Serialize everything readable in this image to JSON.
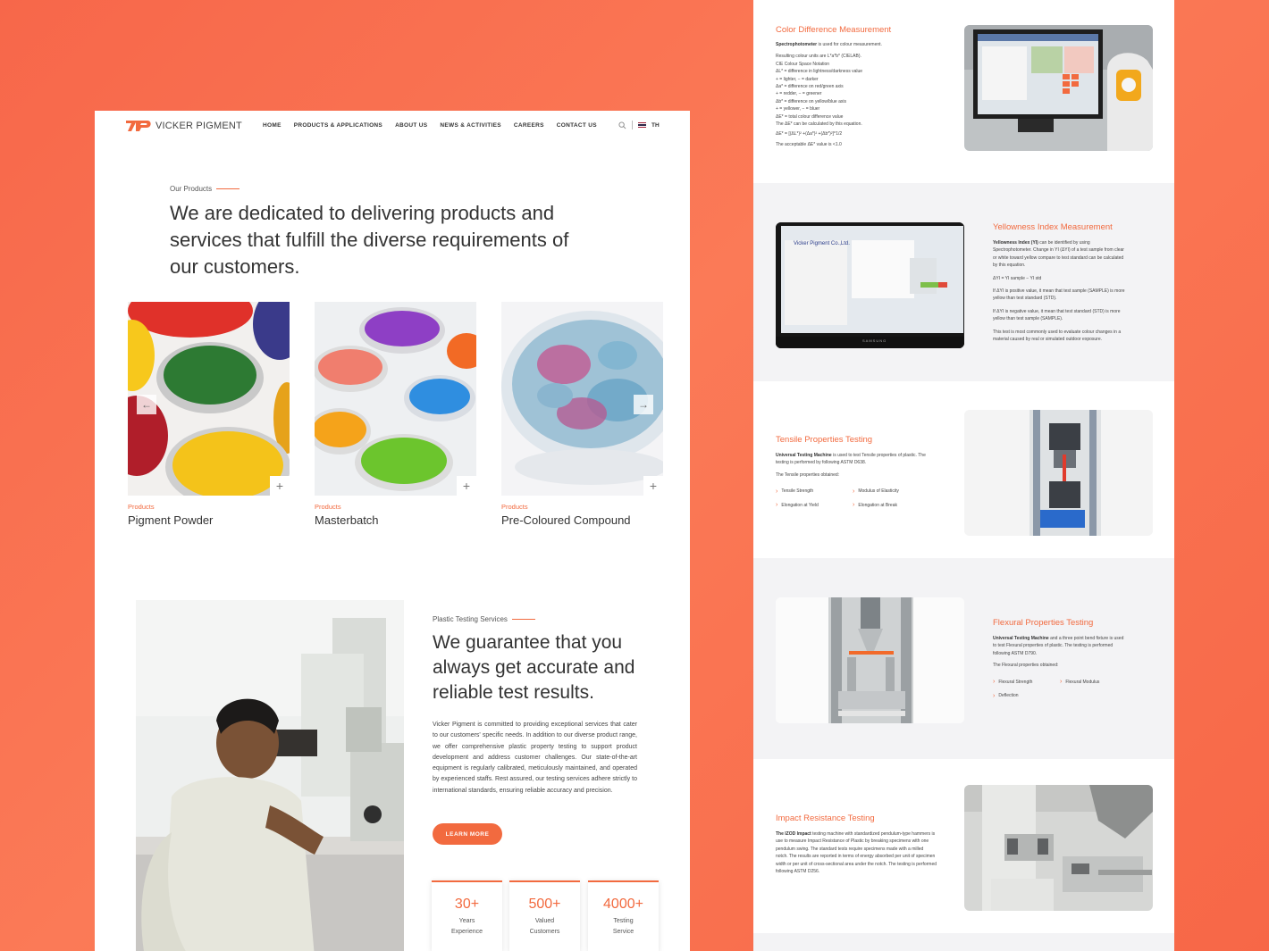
{
  "left_page": {
    "nav": {
      "brand": "VICKER PIGMENT",
      "items": [
        "HOME",
        "PRODUCTS & APPLICATIONS",
        "ABOUT US",
        "NEWS & ACTIVITIES",
        "CAREERS",
        "CONTACT US"
      ],
      "lang": "TH"
    },
    "products_section": {
      "eyebrow": "Our Products",
      "heading": "We are dedicated to delivering products and services that fulfill the diverse requirements of our customers.",
      "cards": [
        {
          "category": "Products",
          "name": "Pigment Powder"
        },
        {
          "category": "Products",
          "name": "Masterbatch"
        },
        {
          "category": "Products",
          "name": "Pre-Coloured Compound"
        }
      ]
    },
    "testing_section": {
      "eyebrow": "Plastic Testing Services",
      "heading": "We guarantee that you always get accurate and reliable test results.",
      "body": "Vicker Pigment is committed to providing exceptional services that cater to our customers' specific needs. In addition to our diverse product range, we offer comprehensive plastic property testing to support product development and address customer challenges. Our state-of-the-art equipment is regularly calibrated, meticulously maintained, and operated by experienced staffs. Rest assured, our testing services adhere strictly to international standards, ensuring reliable accuracy and precision.",
      "cta": "LEARN MORE",
      "stats": [
        {
          "value": "30+",
          "label": "Years\nExperience"
        },
        {
          "value": "500+",
          "label": "Valued\nCustomers"
        },
        {
          "value": "4000+",
          "label": "Testing\nService"
        }
      ]
    }
  },
  "right_page": {
    "color_diff": {
      "title": "Color Difference Measurement",
      "lead_bold": "Spectrophotometer",
      "lead_rest": " is used for colour measurement.",
      "lines": [
        "Resulting colour units are L*a*b* (CIELAB).",
        "CIE Colour Space Notation",
        "ΔL* = difference in lightness/darkness value",
        "+ = lighter, − = darker",
        "Δa* = difference on red/green axis",
        "+ = redder, − = greener",
        "Δb* = difference on yellow/blue axis",
        "+ = yellower, − = bluer",
        "ΔE* = total colour difference value",
        "The ΔE* can be calculated by this equation.",
        "ΔE* = [(ΔL*)² +(Δa*)² +(Δb*)²]^1/2",
        "The acceptable ΔE* value is <1.0"
      ]
    },
    "yellowness": {
      "title": "Yellowness Index Measurement",
      "lead_bold": "Yellowness Index (YI)",
      "lead_rest": " can be identified by using Spectrophotometer. Change in YI (ΔYI) of a test sample from clear or white toward yellow compare to test standard can be calculated by this equation.",
      "lines": [
        "ΔYI = YI sample − YI std",
        "If ΔYI is positive value, it mean that test sample (SAMPLE) is more yellow than test standard (STD).",
        "If ΔYI is negative value, it mean that test standard (STD) is more yellow than test sample (SAMPLE).",
        "This test is most commonly used to evaluate colour changes in a material caused by real or simulated outdoor exposure."
      ],
      "screen_brand": "Vicker Pigment Co.,Ltd.",
      "monitor_brand": "SAMSUNG"
    },
    "tensile": {
      "title": "Tensile Properties Testing",
      "lead_bold": "Universal Testing Machine",
      "lead_rest": " is used to test Tensile properties of plastic. The testing is performed by following ASTM D638.",
      "obtained": "The Tensile properties obtained:",
      "bullets": [
        "Tensile Strength",
        "Modulus of Elasticity",
        "Elongation at Yield",
        "Elongation at Break"
      ]
    },
    "flexural": {
      "title": "Flexural Properties Testing",
      "lead_bold": "Universal Testing Machine",
      "lead_rest": " and a three point bend fixture is used to test Flexural properties of plastic. The testing is performed following ASTM D790.",
      "obtained": "The Flexural properties obtained:",
      "bullets": [
        "Flexural Strength",
        "Flexural Modulus",
        "Deflection"
      ]
    },
    "impact": {
      "title": "Impact Resistance Testing",
      "lead_bold": "The IZOD Impact",
      "lead_rest": " testing machine with standardized pendulum-type hammers is use to measure Impact Resistance of Plastic by breaking specimens with one pendulum swing. The standard tests require specimens made with a milled notch. The results are reported in terms of energy absorbed per unit of specimen width or per unit of cross-sectional area under the notch. The testing is performed following ASTM D256."
    }
  },
  "colors": {
    "accent": "#f26a3f",
    "background": "#f86b4b"
  }
}
